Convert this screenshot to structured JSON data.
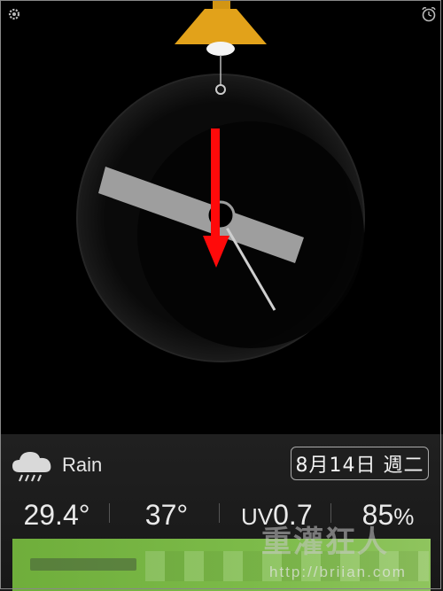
{
  "toolbar": {
    "settings_icon": "gear-icon",
    "alarm_icon": "alarm-clock-icon"
  },
  "clock": {
    "hour_hand_color": "#9e9e9e",
    "second_hand_color": "#cfcfcf",
    "lamp_color": "#e2a21a",
    "arrow_color": "#ff0a0a"
  },
  "weather": {
    "condition": "Rain",
    "condition_icon": "cloud-rain-icon",
    "date": "8月14日 週二",
    "temperature": "29.4°",
    "feels_like": "37°",
    "uv_prefix": "UV",
    "uv_value": "0.7",
    "humidity": "85",
    "humidity_unit": "%"
  },
  "watermark": {
    "title": "重灌狂人",
    "url": "http://briian.com"
  }
}
